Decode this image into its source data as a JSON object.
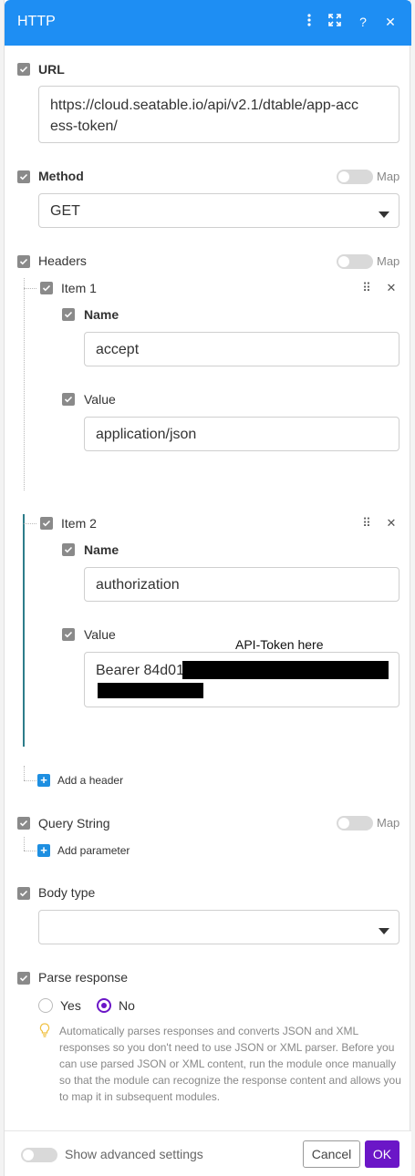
{
  "window": {
    "title": "HTTP"
  },
  "icons": {
    "more": "vertical-dots-icon",
    "expand": "expand-arrows-icon",
    "help": "question-mark-icon",
    "close": "close-icon"
  },
  "url": {
    "label": "URL",
    "value": "https://cloud.seatable.io/api/v2.1/dtable/app-acc",
    "value2": "ess-token/"
  },
  "method": {
    "label": "Method",
    "value": "GET",
    "map_label": "Map"
  },
  "headers": {
    "label": "Headers",
    "map_label": "Map",
    "items": [
      {
        "title": "Item 1",
        "name_label": "Name",
        "name_value": "accept",
        "value_label": "Value",
        "value_value": "application/json"
      },
      {
        "title": "Item 2",
        "name_label": "Name",
        "name_value": "authorization",
        "value_label": "Value",
        "value_value": "Bearer 84d01"
      }
    ],
    "add_label": "Add a header"
  },
  "annotation": "API-Token here",
  "query_string": {
    "label": "Query String",
    "map_label": "Map",
    "add_label": "Add parameter"
  },
  "body_type": {
    "label": "Body type",
    "value": ""
  },
  "parse_response": {
    "label": "Parse response",
    "options": [
      "Yes",
      "No"
    ],
    "selected": "No",
    "help": "Automatically parses responses and converts JSON and XML responses so you don't need to use JSON or XML parser. Before you can use parsed JSON or XML content, run the module once manually so that the module can recognize the response content and allows you to map it in subsequent modules."
  },
  "footer": {
    "advanced_label": "Show advanced settings",
    "cancel_label": "Cancel",
    "ok_label": "OK"
  },
  "colors": {
    "header_blue": "#1e8ef3",
    "ok_purple": "#6b16c7",
    "plus_blue": "#1e8fe1"
  }
}
